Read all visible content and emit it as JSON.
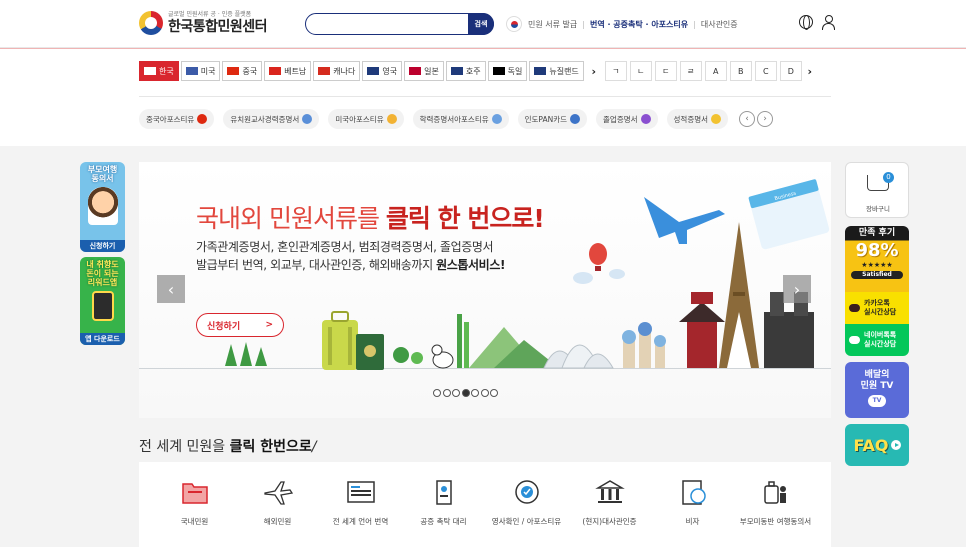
{
  "header": {
    "logo_sub": "글로벌 민원서류 공 · 인증 플랫폼",
    "logo_main": "한국통합민원센터",
    "search_button": "검색",
    "links": {
      "docs": "민원 서류 발급",
      "trans": "번역 · 공증촉탁 · 아포스티유",
      "consul": "대사관인증"
    }
  },
  "countries": [
    {
      "label": "한국",
      "active": true,
      "flag": "#ffffff"
    },
    {
      "label": "미국",
      "active": false,
      "flag": "#3c5ba8"
    },
    {
      "label": "중국",
      "active": false,
      "flag": "#de2910"
    },
    {
      "label": "베트남",
      "active": false,
      "flag": "#da251d"
    },
    {
      "label": "캐나다",
      "active": false,
      "flag": "#d52b1e"
    },
    {
      "label": "영국",
      "active": false,
      "flag": "#1f3a7a"
    },
    {
      "label": "일본",
      "active": false,
      "flag": "#bc002d"
    },
    {
      "label": "호주",
      "active": false,
      "flag": "#1f3a7a"
    },
    {
      "label": "독일",
      "active": false,
      "flag": "#000000"
    },
    {
      "label": "뉴질랜드",
      "active": false,
      "flag": "#1f3a7a"
    }
  ],
  "letters": [
    "ㄱ",
    "ㄴ",
    "ㄷ",
    "ㄹ",
    "A",
    "B",
    "C",
    "D"
  ],
  "docs": [
    {
      "label": "중국아포스티유",
      "color": "#de2910"
    },
    {
      "label": "유치원교사경력증명서",
      "color": "#5a8fd8"
    },
    {
      "label": "미국아포스티유",
      "color": "#f2b233"
    },
    {
      "label": "학력증명서아포스티유",
      "color": "#6aa0e0"
    },
    {
      "label": "인도PAN카드",
      "color": "#3d74c8"
    },
    {
      "label": "졸업증명서",
      "color": "#8a4fd0"
    },
    {
      "label": "성적증명서",
      "color": "#f2c230"
    }
  ],
  "left_banners": {
    "b1_title_1": "부모여행",
    "b1_title_2": "동의서",
    "b1_foot": "신청하기",
    "b2_title_1": "내 취향도",
    "b2_title_2": "돈이 되는",
    "b2_title_3": "리워드앱",
    "b2_foot": "앱 다운로드"
  },
  "banner": {
    "title_normal": "국내외 민원서류를",
    "title_bold": "클릭 한 번으로!",
    "sub_line1": "가족관계증명서, 혼인관계증명서, 범죄경력증명서, 졸업증명서",
    "sub_line2_normal": "발급부터 번역, 외교부, 대사관인증, 해외배송까지",
    "sub_line2_bold": "원스톱서비스!",
    "apply": "신청하기",
    "apply_arrow": ">",
    "ticket_text": "Business",
    "slides_total": 7,
    "slide_active": 4
  },
  "right_sidebar": {
    "cart_count": "0",
    "cart_label": "장바구니",
    "review_title": "만족 후기",
    "review_pct": "98%",
    "review_stars": "★★★★★",
    "review_satisfied": "Satisfied",
    "kakao_1": "카카오톡",
    "kakao_2": "실시간상담",
    "naver_1": "네이버톡톡",
    "naver_2": "실시간상담",
    "tv_1": "배달의",
    "tv_2": "민원 TV",
    "tv_badge": "TV",
    "faq": "FAQ"
  },
  "section": {
    "title_normal": "전 세계 민원을",
    "title_bold": "클릭 한번으로",
    "title_slash": "/"
  },
  "services": [
    {
      "label": "국내민원",
      "icon": "folder-icon"
    },
    {
      "label": "해외민원",
      "icon": "airplane-icon"
    },
    {
      "label": "전 세계 언어 번역",
      "icon": "translate-icon"
    },
    {
      "label": "공증 촉탁 대리",
      "icon": "notary-icon"
    },
    {
      "label": "영사확인 / 아포스티유",
      "icon": "seal-icon"
    },
    {
      "label": "(현지)대사관인증",
      "icon": "embassy-icon"
    },
    {
      "label": "비자",
      "icon": "visa-icon"
    },
    {
      "label": "부모미동반 여행동의서",
      "icon": "travel-consent-icon"
    }
  ]
}
